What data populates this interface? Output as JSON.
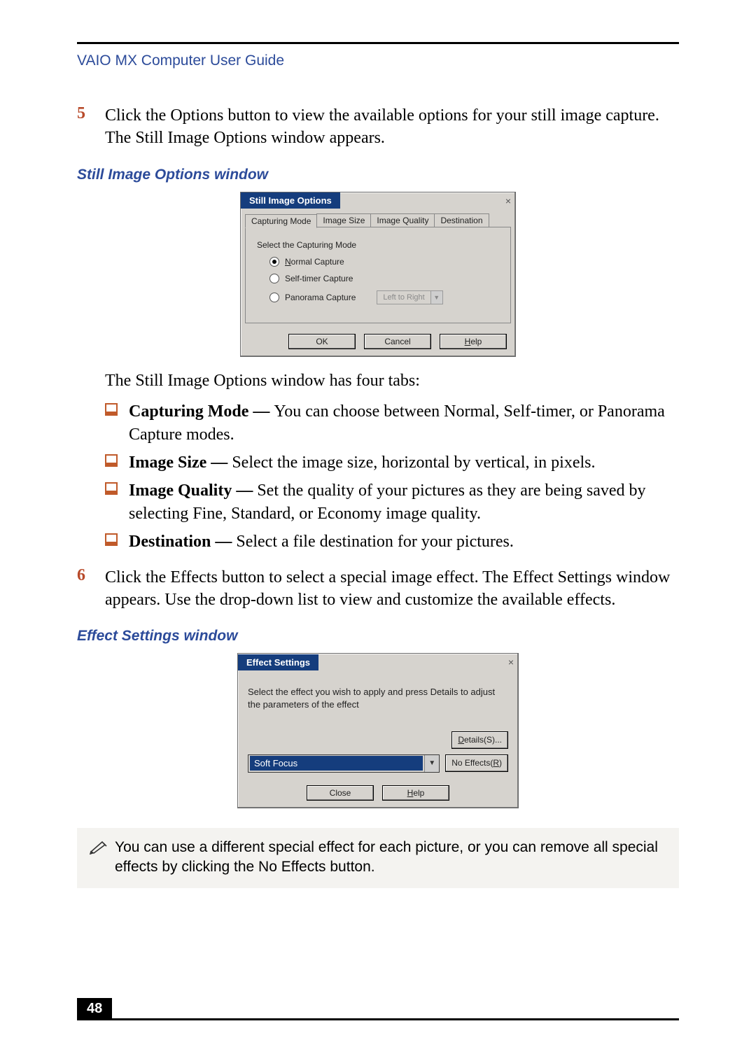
{
  "running_head": "VAIO MX Computer User Guide",
  "steps": {
    "s5": {
      "num": "5",
      "text": "Click the Options button to view the available options for your still image capture. The Still Image Options window appears."
    },
    "s6": {
      "num": "6",
      "text": "Click the Effects button to select a special image effect. The Effect Settings window appears. Use the drop-down list to view and customize the available effects."
    }
  },
  "figcap1": "Still Image Options window",
  "figcap2": "Effect Settings window",
  "still_dialog": {
    "title": "Still Image Options",
    "close": "×",
    "tabs": [
      "Capturing Mode",
      "Image Size",
      "Image Quality",
      "Destination"
    ],
    "prompt": "Select the Capturing Mode",
    "radios": {
      "normal": "Normal Capture",
      "self": "Self-timer Capture",
      "pano": "Panorama Capture"
    },
    "pano_select": "Left to Right",
    "buttons": {
      "ok": "OK",
      "cancel": "Cancel",
      "help_pre": "",
      "help_u": "H",
      "help_post": "elp"
    }
  },
  "after_fig1": "The Still Image Options window has four tabs:",
  "bullets": [
    {
      "b": "Capturing Mode — ",
      "t": "You can choose between Normal, Self-timer, or Panorama Capture modes."
    },
    {
      "b": "Image Size — ",
      "t": "Select the image size, horizontal by vertical, in pixels."
    },
    {
      "b": "Image Quality — ",
      "t": "Set the quality of your pictures as they are being saved by selecting Fine, Standard, or Economy image quality."
    },
    {
      "b": "Destination — ",
      "t": "Select a file destination for your pictures."
    }
  ],
  "effect_dialog": {
    "title": "Effect Settings",
    "close": "×",
    "instr": "Select the effect you wish to apply and press Details to adjust the parameters of the effect",
    "details_pre": "",
    "details_u": "D",
    "details_post": "etails(S)...",
    "selected": "Soft Focus",
    "noeff_pre": "No Effects(",
    "noeff_u": "R",
    "noeff_post": ")",
    "close_btn": "Close",
    "help_u": "H",
    "help_post": "elp"
  },
  "note": "You can use a different special effect for each picture, or you can remove all special effects by clicking the No Effects button.",
  "page_number": "48"
}
